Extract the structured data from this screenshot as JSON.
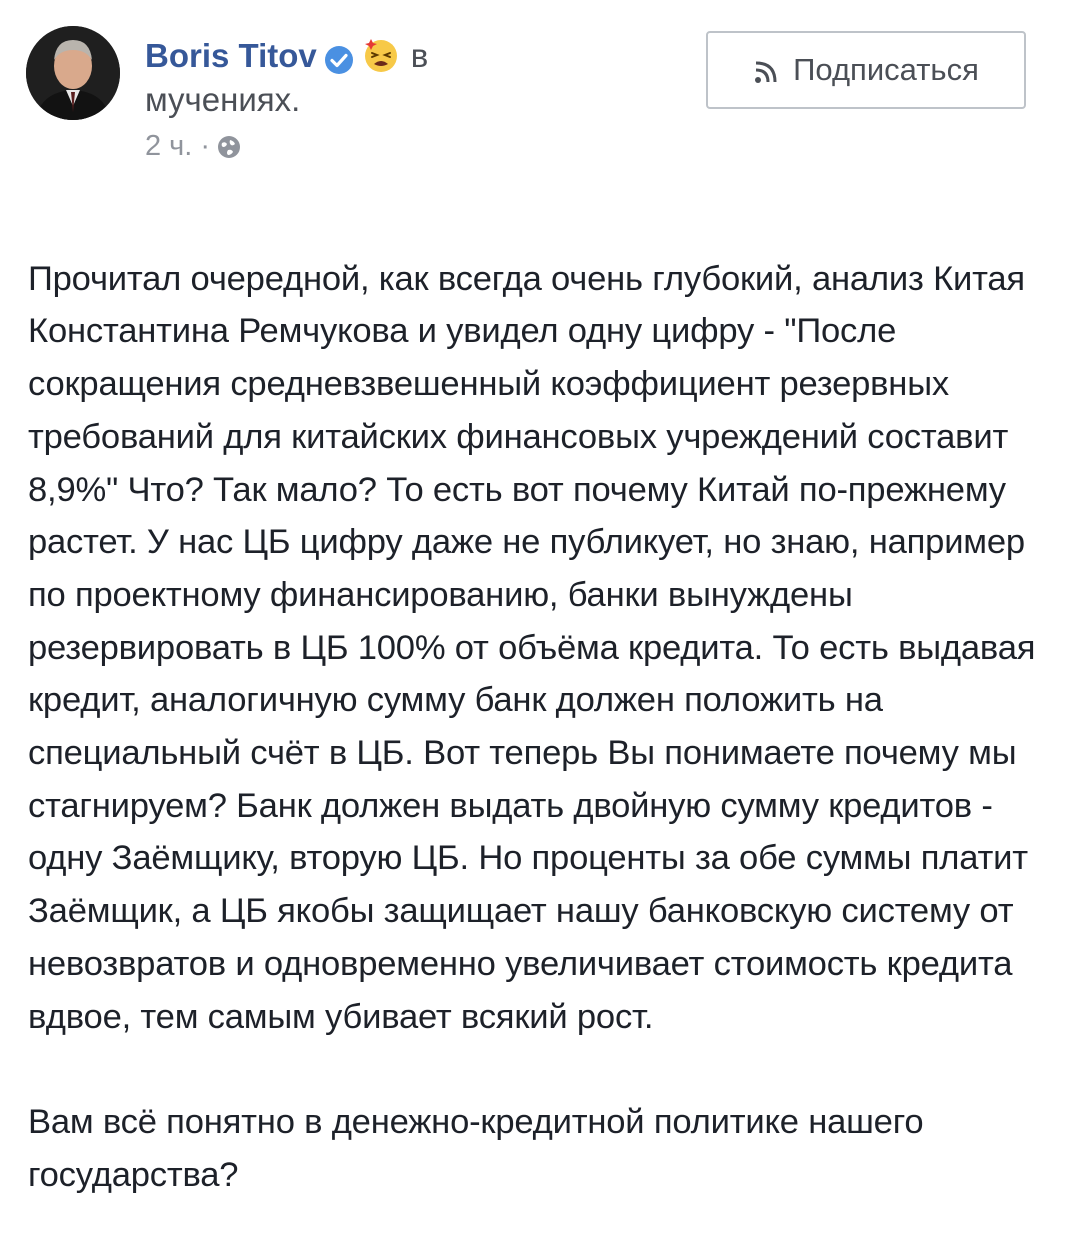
{
  "post": {
    "author_name": "Boris Titov",
    "feeling_prefix": "в",
    "feeling_suffix": "мучениях.",
    "time_label": "2 ч.",
    "separator": "·",
    "subscribe_label": "Подписаться",
    "paragraph_1": "Прочитал очередной, как всегда очень глубокий, анализ Китая Константина Ремчукова и увидел одну цифру - \"После сокращения средневзвешенный коэффициент резервных требований для китайских финансовых учреждений составит 8,9%\" Что? Так мало? То есть вот почему Китай по-прежнему растет. У нас ЦБ цифру даже не публикует, но знаю, например по проектному финансированию, банки вынуждены резервировать в ЦБ 100% от объёма кредита. То есть выдавая кредит, аналогичную сумму банк должен положить на специальный счёт в ЦБ. Вот теперь Вы понимаете почему мы стагнируем? Банк должен выдать двойную сумму кредитов - одну Заёмщику, вторую ЦБ. Но проценты за обе суммы платит Заёмщик, а ЦБ якобы защищает нашу банковскую систему от невозвратов и одновременно увеличивает стоимость кредита вдвое, тем самым убивает всякий рост.",
    "paragraph_2": "Вам всё понятно в денежно-кредитной политике нашего государства?"
  },
  "icons": {
    "verified": "verified-badge-icon",
    "feeling": "tired-face-emoji-icon",
    "privacy": "globe-icon",
    "subscribe": "rss-icon"
  },
  "colors": {
    "author_link": "#365899",
    "verified_badge": "#4a90e2",
    "meta_text": "#90949c",
    "body_text": "#1d2129",
    "button_border": "#bec3c9"
  }
}
